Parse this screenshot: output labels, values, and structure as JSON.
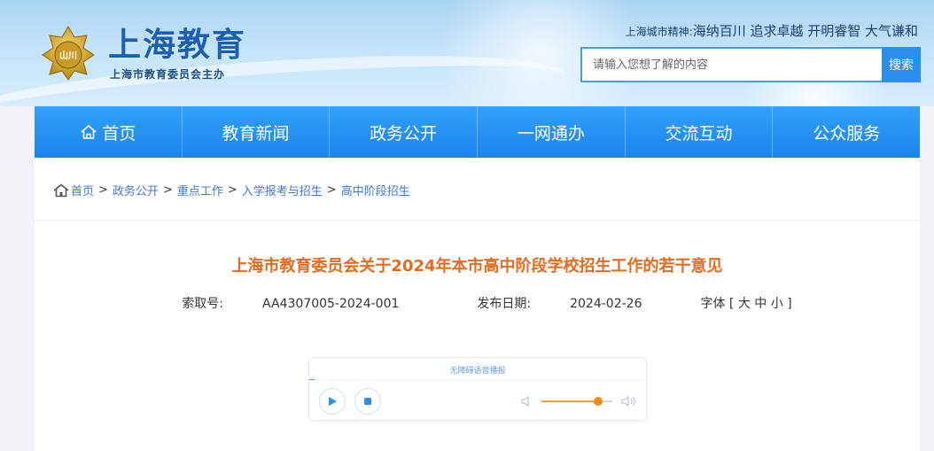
{
  "header": {
    "logo_title": "上海教育",
    "logo_subtitle": "上海市教育委员会主办",
    "emblem_text": "山川",
    "motto_prefix": "上海城市精神:",
    "motto_text": "海纳百川 追求卓越 开明睿智 大气谦和",
    "search_placeholder": "请输入您想了解的内容",
    "search_button": "搜索"
  },
  "nav": {
    "items": [
      {
        "label": "首页",
        "icon": "home-icon"
      },
      {
        "label": "教育新闻"
      },
      {
        "label": "政务公开"
      },
      {
        "label": "一网通办"
      },
      {
        "label": "交流互动"
      },
      {
        "label": "公众服务"
      }
    ]
  },
  "breadcrumb": {
    "items": [
      "首页",
      "政务公开",
      "重点工作",
      "入学报考与招生",
      "高中阶段招生"
    ],
    "separator": ">"
  },
  "article": {
    "title": "上海市教育委员会关于2024年本市高中阶段学校招生工作的若干意见",
    "index_label": "索取号:",
    "index_value": "AA4307005-2024-001",
    "date_label": "发布日期:",
    "date_value": "2024-02-26",
    "font_label": "字体 [ 大 中 小 ]"
  },
  "player": {
    "title": "无障碍语音播报",
    "volume": 0.8,
    "colors": {
      "accent": "#4a9be8",
      "volume": "#f08a18"
    }
  },
  "colors": {
    "nav": "#1a84ec",
    "title": "#e86a1c",
    "link": "#3a7bd5"
  }
}
